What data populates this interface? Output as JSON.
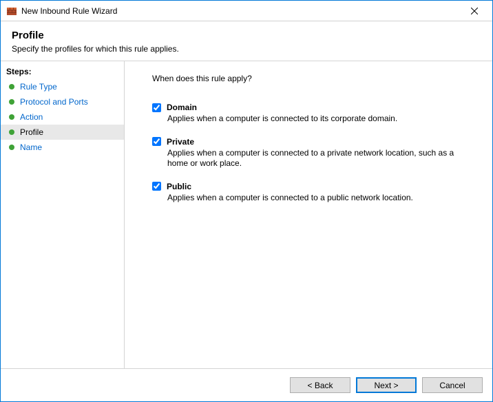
{
  "window": {
    "title": "New Inbound Rule Wizard"
  },
  "header": {
    "title": "Profile",
    "subtitle": "Specify the profiles for which this rule applies."
  },
  "sidebar": {
    "label": "Steps:",
    "items": [
      {
        "label": "Rule Type",
        "current": false
      },
      {
        "label": "Protocol and Ports",
        "current": false
      },
      {
        "label": "Action",
        "current": false
      },
      {
        "label": "Profile",
        "current": true
      },
      {
        "label": "Name",
        "current": false
      }
    ]
  },
  "main": {
    "question": "When does this rule apply?",
    "options": [
      {
        "key": "domain",
        "label": "Domain",
        "checked": true,
        "desc": "Applies when a computer is connected to its corporate domain."
      },
      {
        "key": "private",
        "label": "Private",
        "checked": true,
        "desc": "Applies when a computer is connected to a private network location, such as a home or work place."
      },
      {
        "key": "public",
        "label": "Public",
        "checked": true,
        "desc": "Applies when a computer is connected to a public network location."
      }
    ]
  },
  "footer": {
    "back": "< Back",
    "next": "Next >",
    "cancel": "Cancel"
  }
}
